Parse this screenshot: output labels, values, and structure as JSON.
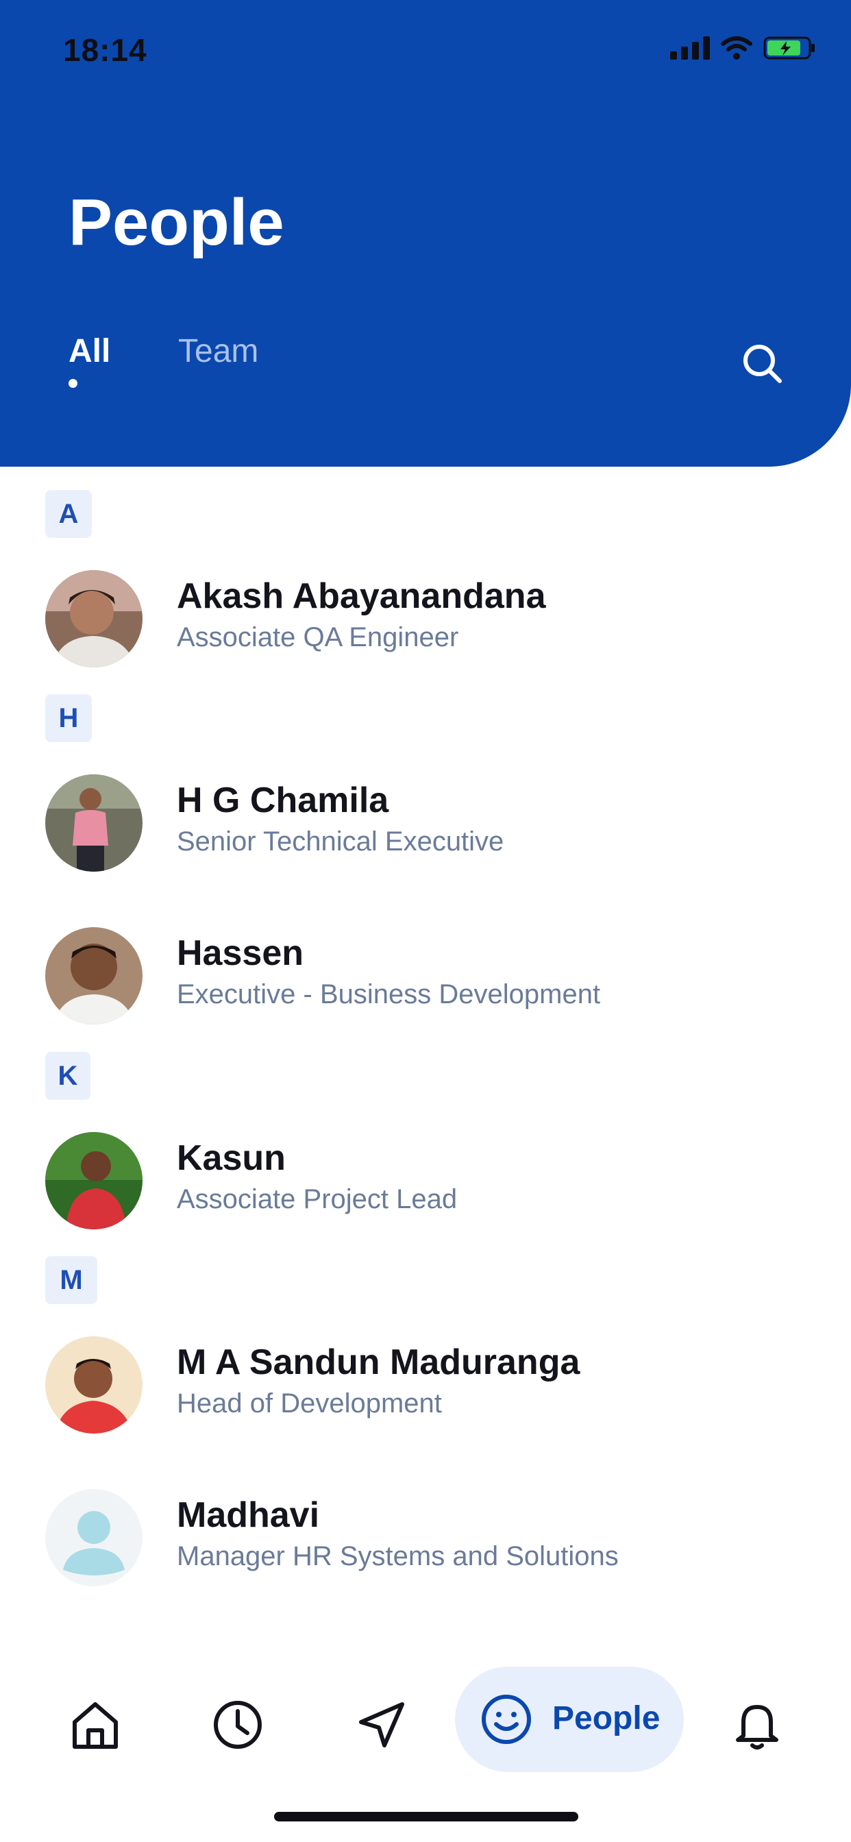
{
  "status_bar": {
    "time": "18:14"
  },
  "header": {
    "title": "People",
    "tabs": {
      "all": "All",
      "team": "Team"
    }
  },
  "sections": [
    {
      "letter": "A"
    },
    {
      "letter": "H"
    },
    {
      "letter": "K"
    },
    {
      "letter": "M"
    }
  ],
  "people": [
    {
      "name": "Akash Abayanandana",
      "role": "Associate QA Engineer"
    },
    {
      "name": "H G Chamila",
      "role": "Senior Technical Executive"
    },
    {
      "name": "Hassen",
      "role": "Executive - Business Development"
    },
    {
      "name": "Kasun",
      "role": "Associate Project Lead"
    },
    {
      "name": "M A Sandun Maduranga",
      "role": "Head of Development"
    },
    {
      "name": "Madhavi",
      "role": "Manager HR Systems and Solutions"
    }
  ],
  "bottom_nav": {
    "items": [
      "home-icon",
      "clock-icon",
      "navigation-icon",
      "smiley-icon",
      "bell-icon"
    ],
    "active_label": "People"
  },
  "colors": {
    "header_bg": "#0b48ad",
    "accent": "#0b48ad",
    "section_chip_bg": "#eaf0fb",
    "role_text": "#6a7b98"
  }
}
